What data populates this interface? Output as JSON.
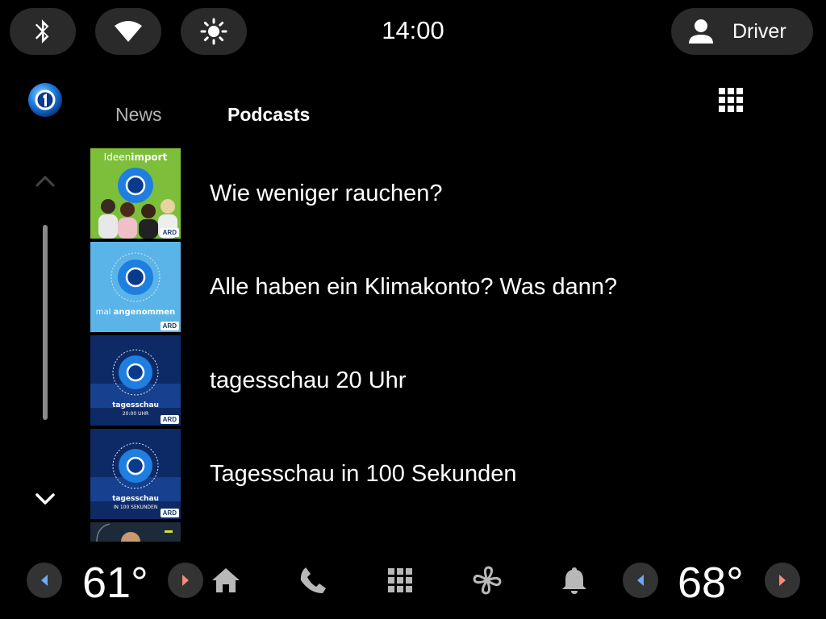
{
  "status_bar": {
    "time": "14:00",
    "profile_label": "Driver",
    "icons": [
      "bluetooth-icon",
      "wifi-icon",
      "brightness-icon",
      "person-icon"
    ]
  },
  "app": {
    "logo_icon": "tagesschau-logo",
    "tabs": [
      {
        "label": "News",
        "selected": false
      },
      {
        "label": "Podcasts",
        "selected": true
      }
    ],
    "apps_icon": "grid-icon"
  },
  "podcasts": [
    {
      "title": "Wie weniger rauchen?",
      "thumb_caption_a": "Ideen",
      "thumb_caption_b": "import",
      "thumb_bg": "#7dbf3a"
    },
    {
      "title": "Alle haben ein Klimakonto? Was dann?",
      "thumb_caption_a": "mal",
      "thumb_caption_b": "angenommen",
      "thumb_bg": "#5ab4e8"
    },
    {
      "title": "tagesschau 20 Uhr",
      "thumb_caption_a": "tagesschau",
      "thumb_caption_b": "20:00 UHR",
      "thumb_bg": "#0e2a66"
    },
    {
      "title": "Tagesschau in 100 Sekunden",
      "thumb_caption_a": "tagesschau",
      "thumb_caption_b": "IN 100 SEKUNDEN",
      "thumb_bg": "#0e2a66"
    },
    {
      "title": "",
      "thumb_bg": "#1c2a3a"
    }
  ],
  "thumb_badge": "ARD",
  "climate": {
    "left_temp": "61°",
    "right_temp": "68°",
    "arrow_left_color": "#6fa8f5",
    "arrow_right_color": "#f28b78"
  },
  "nav": [
    "home-icon",
    "phone-icon",
    "apps-grid-icon",
    "fan-icon",
    "bell-icon"
  ]
}
